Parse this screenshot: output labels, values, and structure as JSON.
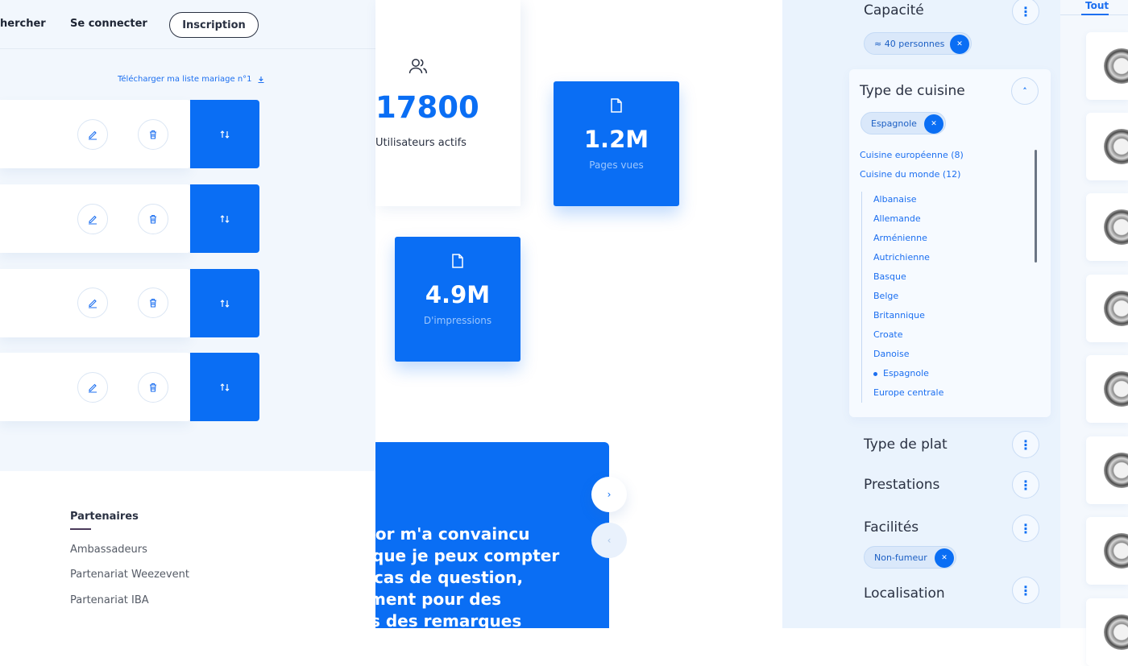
{
  "header": {
    "search_label": "hercher",
    "login_label": "Se connecter",
    "signup_label": "Inscription"
  },
  "wishlist": {
    "download_label": "Télécharger ma liste mariage n°1",
    "row_count": 4
  },
  "footer": {
    "partners_title": "Partenaires",
    "links": [
      "Ambassadeurs",
      "Partenariat Weezevent",
      "Partenariat IBA"
    ]
  },
  "stats": {
    "users": {
      "value": "17800",
      "label": "Utilisateurs actifs",
      "icon": "users-icon"
    },
    "page_views": {
      "value": "1.2M",
      "label": "Pages vues",
      "icon": "document-icon"
    },
    "impressions": {
      "value": "4.9M",
      "label": "D'impressions",
      "icon": "document-icon"
    }
  },
  "testimonial": {
    "lines": [
      "sor m'a convaincu",
      "que je peux compter",
      "cas de question,",
      "ment pour des",
      "s des  remarques"
    ]
  },
  "filters": {
    "capacity": {
      "title": "Capacité",
      "chip": "≈ 40 personnes"
    },
    "cuisine": {
      "title": "Type de cuisine",
      "chip": "Espagnole",
      "categories": [
        "Cuisine européenne (8)",
        "Cuisine du monde (12)"
      ],
      "items": [
        "Albanaise",
        "Allemande",
        "Arménienne",
        "Autrichienne",
        "Basque",
        "Belge",
        "Britannique",
        "Croate",
        "Danoise",
        "Espagnole",
        "Europe centrale"
      ],
      "selected": "Espagnole"
    },
    "dish_type": {
      "title": "Type de plat"
    },
    "services": {
      "title": "Prestations"
    },
    "facilities": {
      "title": "Facilités",
      "chip": "Non-fumeur"
    },
    "location": {
      "title": "Localisation"
    }
  },
  "results": {
    "tab_label": "Tout",
    "thumb_count": 8
  },
  "colors": {
    "accent": "#0a6ef4",
    "panel_bg": "#eaf3fd",
    "link": "#1c6ff0"
  }
}
